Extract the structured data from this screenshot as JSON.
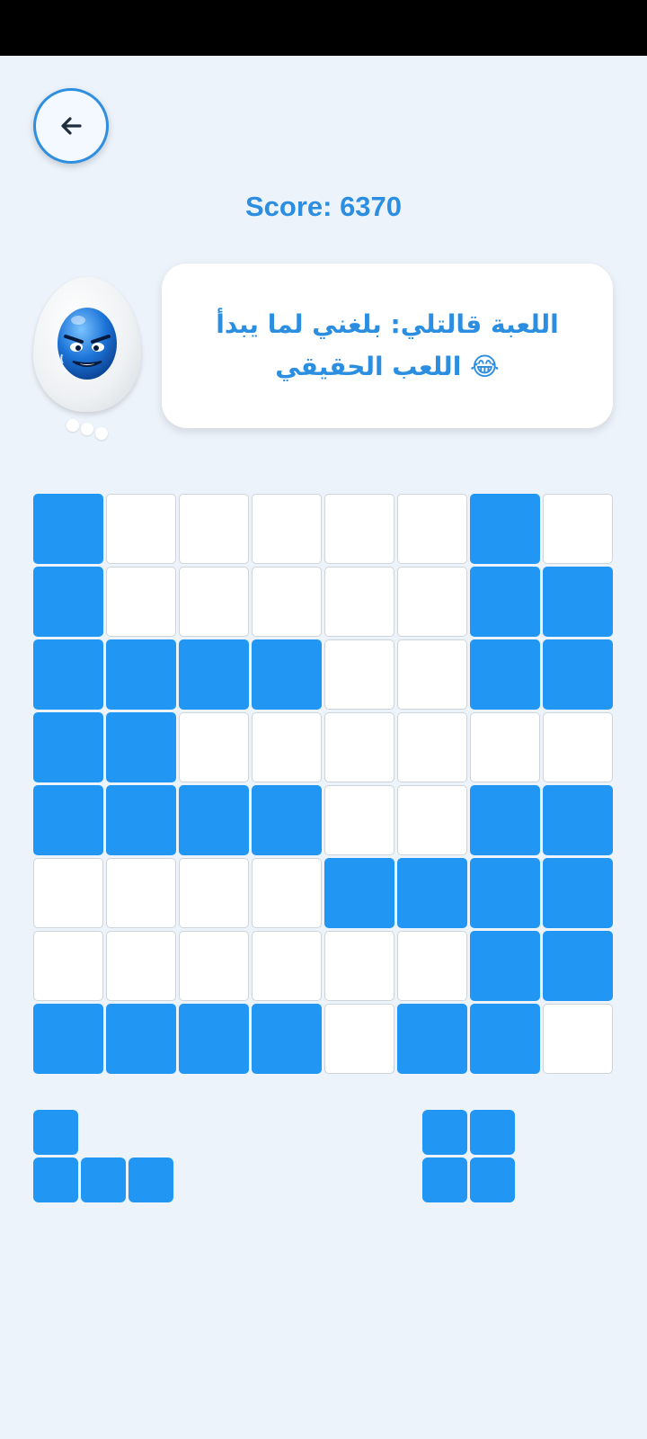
{
  "header": {
    "back_icon": "arrow-left-icon",
    "score_text": "Score: 6370"
  },
  "character": {
    "avatar": "blue-egg-angry-face",
    "speech_line1": "اللعبة قالتلي: بلغني لما يبدأ",
    "speech_line2": "😂 اللعب الحقيقي"
  },
  "colors": {
    "accent": "#2e8fe0",
    "block": "#2196f3",
    "background": "#edf3fb"
  },
  "board": {
    "rows": [
      [
        1,
        0,
        0,
        0,
        0,
        0,
        1,
        0
      ],
      [
        1,
        0,
        0,
        0,
        0,
        0,
        1,
        1
      ],
      [
        1,
        1,
        1,
        1,
        0,
        0,
        1,
        1
      ],
      [
        1,
        1,
        0,
        0,
        0,
        0,
        0,
        0
      ],
      [
        1,
        1,
        1,
        1,
        0,
        0,
        1,
        1
      ],
      [
        0,
        0,
        0,
        0,
        1,
        1,
        1,
        1
      ],
      [
        0,
        0,
        0,
        0,
        0,
        0,
        1,
        1
      ],
      [
        1,
        1,
        1,
        1,
        0,
        1,
        1,
        0
      ]
    ]
  },
  "pieces": [
    {
      "name": "piece-l-shape",
      "shape": [
        [
          1,
          0,
          0
        ],
        [
          1,
          1,
          1
        ]
      ]
    },
    {
      "name": "piece-square",
      "shape": [
        [
          1,
          1
        ],
        [
          1,
          1
        ]
      ]
    }
  ]
}
